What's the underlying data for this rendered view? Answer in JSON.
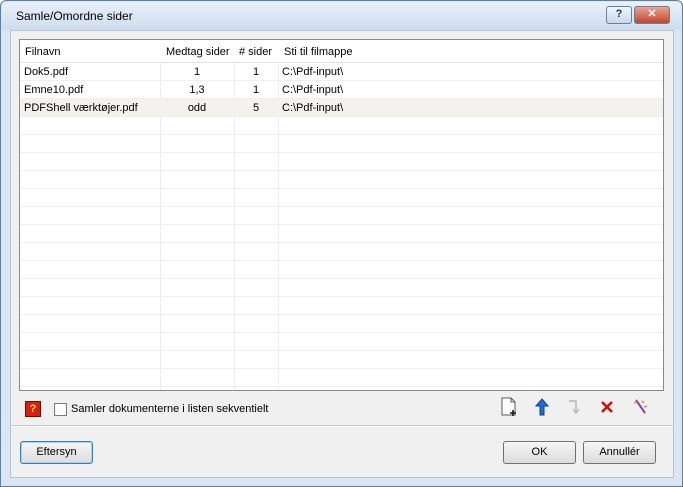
{
  "window": {
    "title": "Samle/Omordne sider",
    "help_glyph": "?",
    "close_glyph": "✕"
  },
  "table": {
    "columns": [
      "Filnavn",
      "Medtag sider",
      "# sider",
      "Sti til filmappe"
    ],
    "rows": [
      {
        "name": "Dok5.pdf",
        "pages": "1",
        "count": "1",
        "path": "C:\\Pdf-input\\"
      },
      {
        "name": "Emne10.pdf",
        "pages": "1,3",
        "count": "1",
        "path": "C:\\Pdf-input\\"
      },
      {
        "name": "PDFShell værktøjer.pdf",
        "pages": "odd",
        "count": "5",
        "path": "C:\\Pdf-input\\"
      }
    ]
  },
  "options": {
    "sequential_label": "Samler dokumenterne i listen sekventielt",
    "sequential_checked": false
  },
  "toolbar": {
    "add_icon": "add-document-icon",
    "up_icon": "move-up-icon",
    "down_icon": "move-down-icon",
    "delete_icon": "delete-icon",
    "clear_icon": "wand-icon",
    "help_icon": "help-icon"
  },
  "buttons": {
    "preview": "Eftersyn",
    "ok": "OK",
    "cancel": "Annullér"
  },
  "colors": {
    "delete": "#cc1111",
    "up": "#1f6fd1",
    "help_bg": "#d72014"
  }
}
